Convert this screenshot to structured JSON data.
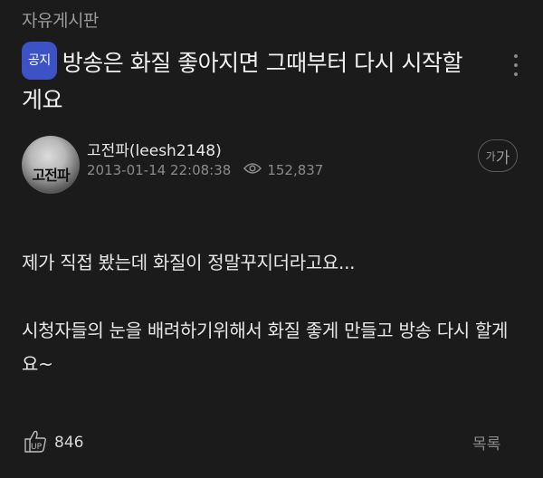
{
  "board": {
    "name": "자유게시판"
  },
  "post": {
    "badge": "공지",
    "title": "방송은 화질 좋아지면 그때부터 다시 시작할게요",
    "author": "고전파(leesh2148)",
    "avatar_text": "고전파",
    "datetime": "2013-01-14 22:08:38",
    "views": "152,837",
    "body": [
      "제가 직접 봤는데 화질이 정말꾸지더라고요...",
      "시청자들의 눈을 배려하기위해서 화질 좋게 만들고 방송 다시 할게요~"
    ]
  },
  "font_size_button": {
    "small": "가",
    "large": "가"
  },
  "actions": {
    "like_label": "UP",
    "like_count": "846",
    "list_label": "목록"
  },
  "colors": {
    "background": "#1b1b1b",
    "badge": "#3d52c4",
    "muted": "#8a8a8a"
  },
  "icons": [
    "more-vertical-icon",
    "eye-icon",
    "thumbs-up-icon"
  ]
}
